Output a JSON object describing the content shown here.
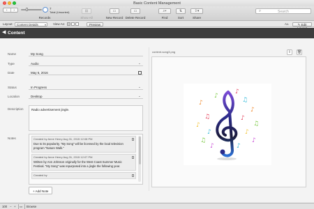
{
  "window": {
    "title": "Basic Content Management"
  },
  "toolbar": {
    "records": {
      "current": "1",
      "label": "Records",
      "total_count": "7",
      "total_text": "Total (Unsorted)"
    },
    "show_all": "Show All",
    "new_record": "New Record",
    "delete_record": "Delete Record",
    "find": "Find",
    "sort": "Sort",
    "share": "Share",
    "search_placeholder": "Search"
  },
  "layout_bar": {
    "layout_label": "Layout:",
    "layout_value": "Content Details",
    "view_as_label": "View As:",
    "preview_label": "Preview",
    "edit_layout_label": "Edit Layout"
  },
  "header": {
    "title": "Content"
  },
  "fields": {
    "name": {
      "label": "Name",
      "value": "My Song"
    },
    "type": {
      "label": "Type",
      "value": "Audio"
    },
    "date": {
      "label": "Date",
      "value": "May 6, 2016"
    },
    "status": {
      "label": "Status",
      "value": "In Progress"
    },
    "location": {
      "label": "Location",
      "value": "Desktop"
    },
    "description": {
      "label": "Description",
      "value": "Radio advertisement jingle."
    }
  },
  "notes": {
    "label": "Notes",
    "items": [
      {
        "meta": "Created by Anne Henry Aug 31, 2015 12:08 PM",
        "lines": [
          "Due to its popularity, \"My Song\" will be licensed by the local television",
          "program \"Nature Walk.\""
        ]
      },
      {
        "meta": "Created by Anne Henry Aug 31, 2015 12:07 PM",
        "lines": [
          "Written by Ann Johnson originally for the West Coast Summer Music",
          "Festival. \"My Song\" was repurposed into a jingle the following year."
        ]
      },
      {
        "meta": "Created by",
        "lines": []
      }
    ],
    "add_label": "+ Add Note"
  },
  "image": {
    "filename": "content-song3.png"
  },
  "statusbar": {
    "zoom": "100",
    "mode": "Browse"
  },
  "colors": {
    "header_bg": "#3d3d3d",
    "accent": "#5b8fd3"
  }
}
